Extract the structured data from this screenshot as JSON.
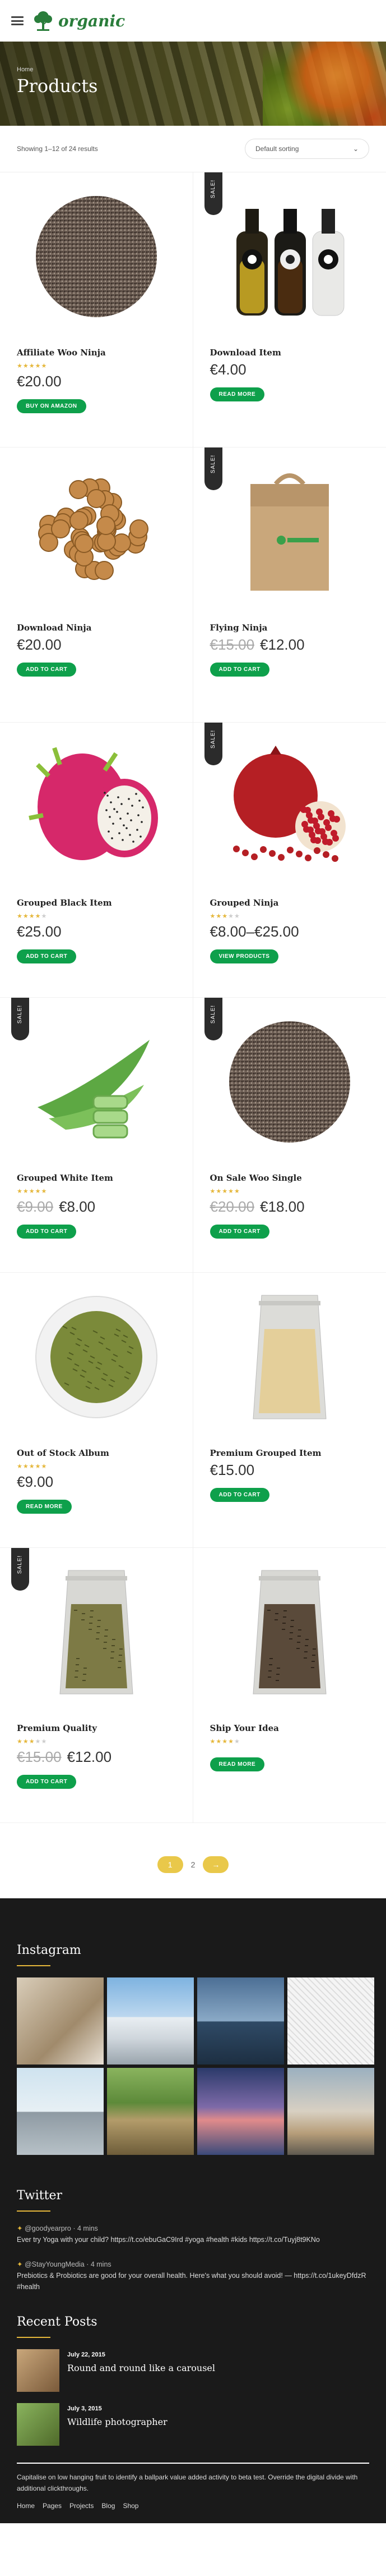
{
  "header": {
    "logo_text": "organic"
  },
  "hero": {
    "breadcrumb": "Home",
    "title": "Products"
  },
  "toolbar": {
    "result_count": "Showing 1–12 of 24 results",
    "sort_label": "Default sorting"
  },
  "products": [
    {
      "name": "Affiliate Woo Ninja",
      "stars": 5,
      "price": "€20.00",
      "old_price": "",
      "button": "BUY ON AMAZON",
      "sale": false,
      "image": "chia-seeds"
    },
    {
      "name": "Download Item",
      "stars": 0,
      "price": "€4.00",
      "old_price": "",
      "button": "READ MORE",
      "sale": true,
      "image": "oil-bottles"
    },
    {
      "name": "Download Ninja",
      "stars": 0,
      "price": "€20.00",
      "old_price": "",
      "button": "ADD TO CART",
      "sale": false,
      "image": "mulberries"
    },
    {
      "name": "Flying Ninja",
      "stars": 0,
      "price": "€12.00",
      "old_price": "€15.00",
      "button": "ADD TO CART",
      "sale": true,
      "image": "paper-bag"
    },
    {
      "name": "Grouped Black Item",
      "stars": 4,
      "price": "€25.00",
      "old_price": "",
      "button": "ADD TO CART",
      "sale": false,
      "image": "dragon-fruit"
    },
    {
      "name": "Grouped Ninja",
      "stars": 3,
      "price": "€8.00–€25.00",
      "old_price": "",
      "button": "VIEW PRODUCTS",
      "sale": true,
      "image": "pomegranate"
    },
    {
      "name": "Grouped White Item",
      "stars": 5,
      "price": "€8.00",
      "old_price": "€9.00",
      "button": "ADD TO CART",
      "sale": true,
      "image": "aloe-vera"
    },
    {
      "name": "On Sale Woo Single",
      "stars": 5,
      "price": "€18.00",
      "old_price": "€20.00",
      "button": "ADD TO CART",
      "sale": true,
      "image": "chia-seeds"
    },
    {
      "name": "Out of Stock Album",
      "stars": 5,
      "price": "€9.00",
      "old_price": "",
      "button": "READ MORE",
      "sale": false,
      "image": "green-tea"
    },
    {
      "name": "Premium Grouped Item",
      "stars": 0,
      "price": "€15.00",
      "old_price": "",
      "button": "ADD TO CART",
      "sale": false,
      "image": "rice-bag"
    },
    {
      "name": "Premium Quality",
      "stars": 3,
      "price": "€12.00",
      "old_price": "€15.00",
      "button": "ADD TO CART",
      "sale": true,
      "image": "tea-bag"
    },
    {
      "name": "Ship Your Idea",
      "stars": 4,
      "price": "",
      "old_price": "",
      "button": "READ MORE",
      "sale": false,
      "image": "tea-bag-dark"
    }
  ],
  "pagination": {
    "current": "1",
    "next_page": "2",
    "next_arrow": "→"
  },
  "footer": {
    "instagram_title": "Instagram",
    "twitter_title": "Twitter",
    "tweets": [
      {
        "handle": "@goodyearpro",
        "time": "· 4 mins",
        "text": "Ever try Yoga with your child? https://t.co/ebuGaC9Ird #yoga #health #kids https://t.co/Tuyj8t9KNo"
      },
      {
        "handle": "@StayYoungMedia",
        "time": "· 4 mins",
        "text": "Prebiotics & Probiotics are good for your overall health. Here's what you should avoid! — https://t.co/1ukeyDfdzR #health"
      }
    ],
    "recent_posts_title": "Recent Posts",
    "posts": [
      {
        "date": "July 22, 2015",
        "title": "Round and round like a carousel"
      },
      {
        "date": "July 3, 2015",
        "title": "Wildlife photographer"
      }
    ],
    "about_text": "Capitalise on low hanging fruit to identify a ballpark value added activity to beta test. Override the digital divide with additional clickthroughs.",
    "menu": [
      "Home",
      "Pages",
      "Projects",
      "Blog",
      "Shop"
    ]
  }
}
